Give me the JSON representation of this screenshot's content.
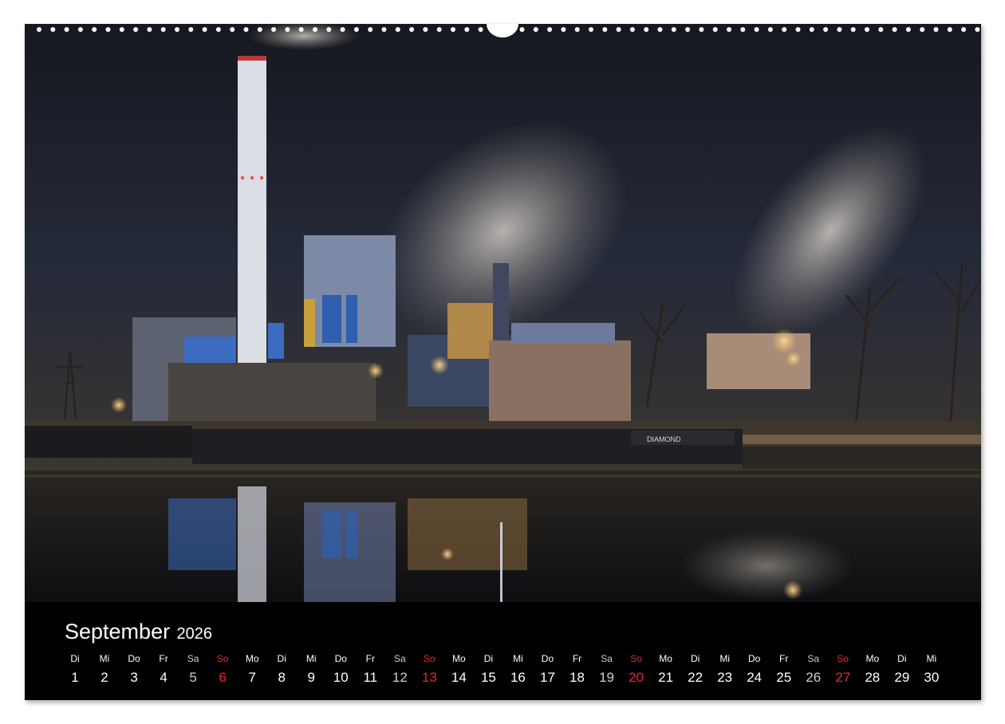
{
  "calendar": {
    "month": "September",
    "year": "2026",
    "days": [
      {
        "dow": "Di",
        "day": "1",
        "kind": "weekday"
      },
      {
        "dow": "Mi",
        "day": "2",
        "kind": "weekday"
      },
      {
        "dow": "Do",
        "day": "3",
        "kind": "weekday"
      },
      {
        "dow": "Fr",
        "day": "4",
        "kind": "weekday"
      },
      {
        "dow": "Sa",
        "day": "5",
        "kind": "saturday"
      },
      {
        "dow": "So",
        "day": "6",
        "kind": "sunday"
      },
      {
        "dow": "Mo",
        "day": "7",
        "kind": "weekday"
      },
      {
        "dow": "Di",
        "day": "8",
        "kind": "weekday"
      },
      {
        "dow": "Mi",
        "day": "9",
        "kind": "weekday"
      },
      {
        "dow": "Do",
        "day": "10",
        "kind": "weekday"
      },
      {
        "dow": "Fr",
        "day": "11",
        "kind": "weekday"
      },
      {
        "dow": "Sa",
        "day": "12",
        "kind": "saturday"
      },
      {
        "dow": "So",
        "day": "13",
        "kind": "sunday"
      },
      {
        "dow": "Mo",
        "day": "14",
        "kind": "weekday"
      },
      {
        "dow": "Di",
        "day": "15",
        "kind": "weekday"
      },
      {
        "dow": "Mi",
        "day": "16",
        "kind": "weekday"
      },
      {
        "dow": "Do",
        "day": "17",
        "kind": "weekday"
      },
      {
        "dow": "Fr",
        "day": "18",
        "kind": "weekday"
      },
      {
        "dow": "Sa",
        "day": "19",
        "kind": "saturday"
      },
      {
        "dow": "So",
        "day": "20",
        "kind": "sunday"
      },
      {
        "dow": "Mo",
        "day": "21",
        "kind": "weekday"
      },
      {
        "dow": "Di",
        "day": "22",
        "kind": "weekday"
      },
      {
        "dow": "Mi",
        "day": "23",
        "kind": "weekday"
      },
      {
        "dow": "Do",
        "day": "24",
        "kind": "weekday"
      },
      {
        "dow": "Fr",
        "day": "25",
        "kind": "weekday"
      },
      {
        "dow": "Sa",
        "day": "26",
        "kind": "saturday"
      },
      {
        "dow": "So",
        "day": "27",
        "kind": "sunday"
      },
      {
        "dow": "Mo",
        "day": "28",
        "kind": "weekday"
      },
      {
        "dow": "Di",
        "day": "29",
        "kind": "weekday"
      },
      {
        "dow": "Mi",
        "day": "30",
        "kind": "weekday"
      }
    ]
  },
  "barge_name": "DIAMOND",
  "colors": {
    "sky": "#1b1f2e",
    "panel": "#000000",
    "weekday_text": "#ffffff",
    "saturday_text": "#cfcfcf",
    "sunday_text": "#e8262b",
    "building_blue": "#2f5fae",
    "lamp_glow": "#f4b864"
  }
}
